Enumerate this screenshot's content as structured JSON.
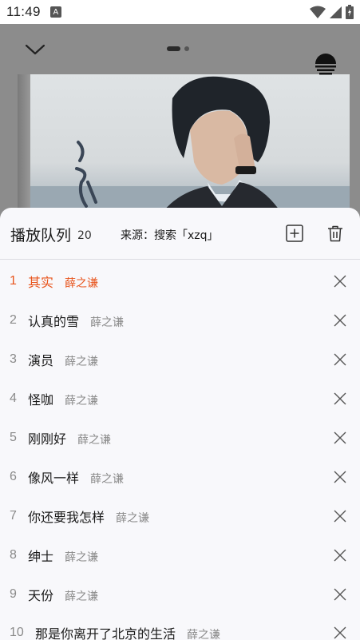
{
  "status_bar": {
    "time": "11:49",
    "notification_glyph": "A"
  },
  "player": {
    "page_indicator": {
      "active": 0,
      "count": 2
    }
  },
  "queue": {
    "title": "播放队列",
    "count": "20",
    "source": "来源：搜索「xzq」",
    "songs": [
      {
        "num": "1",
        "title": "其实",
        "artist": "薛之谦",
        "active": true
      },
      {
        "num": "2",
        "title": "认真的雪",
        "artist": "薛之谦"
      },
      {
        "num": "3",
        "title": "演员",
        "artist": "薛之谦"
      },
      {
        "num": "4",
        "title": "怪咖",
        "artist": "薛之谦"
      },
      {
        "num": "5",
        "title": "刚刚好",
        "artist": "薛之谦"
      },
      {
        "num": "6",
        "title": "像风一样",
        "artist": "薛之谦"
      },
      {
        "num": "7",
        "title": "你还要我怎样",
        "artist": "薛之谦"
      },
      {
        "num": "8",
        "title": "绅士",
        "artist": "薛之谦"
      },
      {
        "num": "9",
        "title": "天份",
        "artist": "薛之谦"
      },
      {
        "num": "10",
        "title": "那是你离开了北京的生活",
        "artist": "薛之谦"
      }
    ]
  },
  "colors": {
    "accent": "#e8541c",
    "sheet_bg": "#f8f8fb",
    "text": "#1a1a1a",
    "muted": "#8a8a8a"
  },
  "icons": {
    "collapse": "chevron-down-icon",
    "mode": "playback-mode-icon",
    "add": "add-to-playlist-icon",
    "clear": "trash-icon",
    "remove": "close-icon"
  }
}
